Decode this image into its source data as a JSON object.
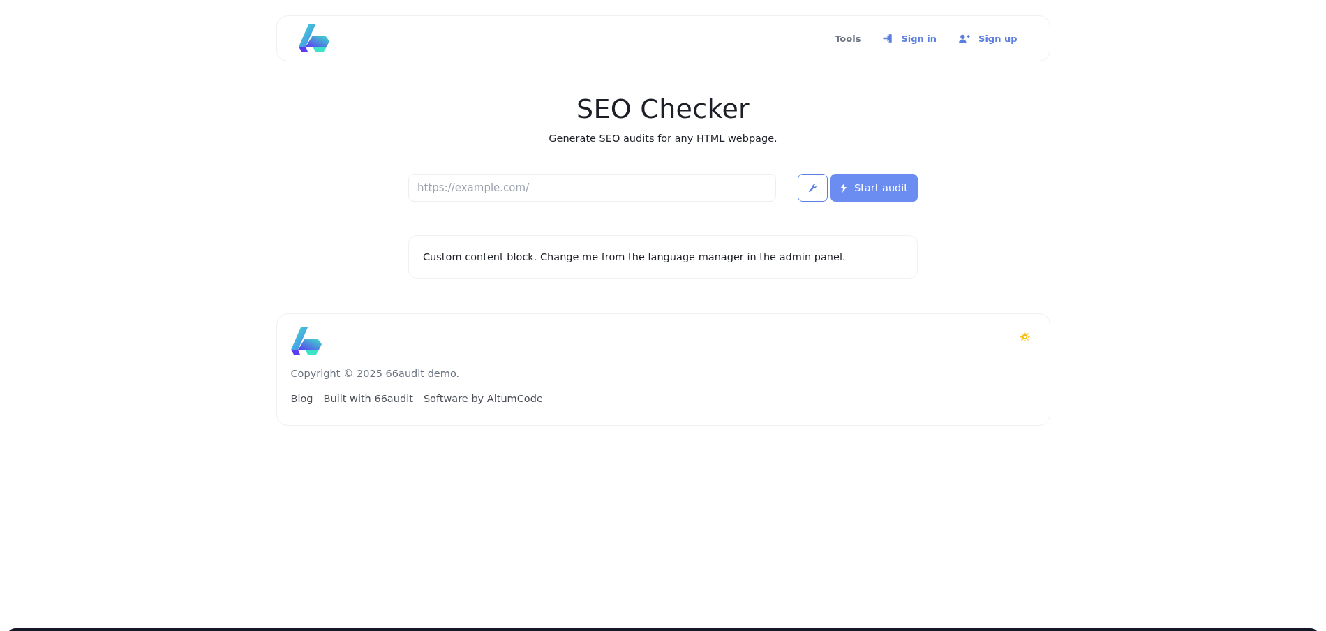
{
  "header": {
    "nav": [
      {
        "label": "Tools",
        "kind": "plain"
      },
      {
        "label": "Sign in",
        "kind": "signin"
      },
      {
        "label": "Sign up",
        "kind": "signup"
      }
    ]
  },
  "hero": {
    "title": "SEO Checker",
    "subtitle": "Generate SEO audits for any HTML webpage."
  },
  "audit_form": {
    "placeholder": "https://example.com/",
    "button": "Start audit"
  },
  "content_block": {
    "text": "Custom content block. Change me from the language manager in the admin panel."
  },
  "footer": {
    "copyright": "Copyright © 2025 66audit demo.",
    "links": [
      "Blog",
      "Built with 66audit",
      "Software by AltumCode"
    ]
  }
}
